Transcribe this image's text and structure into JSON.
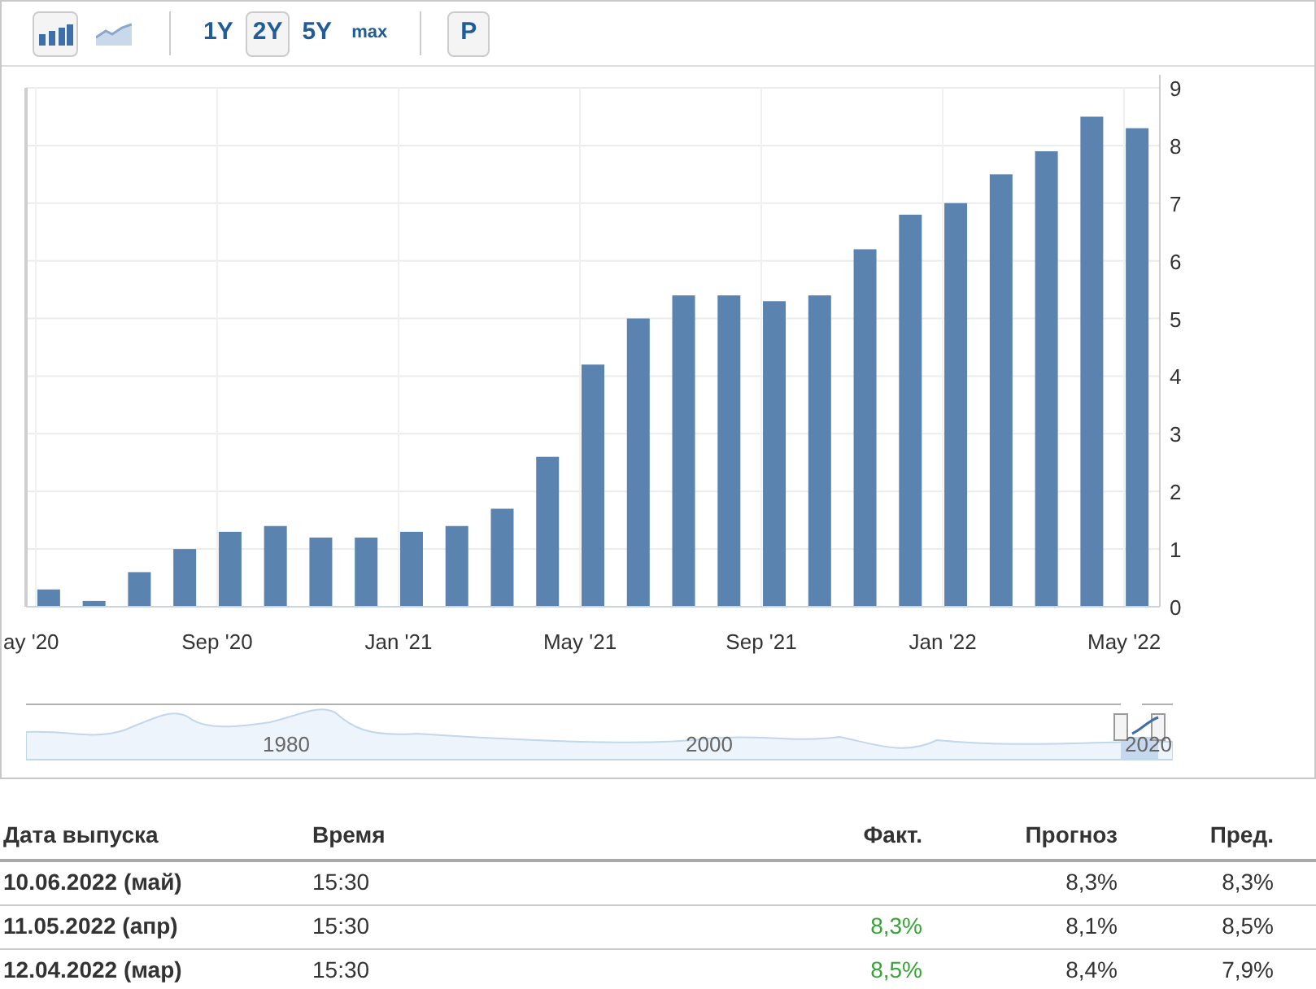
{
  "toolbar": {
    "chart_types": [
      {
        "kind": "bar",
        "selected": true
      },
      {
        "kind": "line",
        "selected": false
      }
    ],
    "ranges": [
      {
        "label": "1Y",
        "selected": false
      },
      {
        "label": "2Y",
        "selected": true
      },
      {
        "label": "5Y",
        "selected": false
      },
      {
        "label": "max",
        "selected": false
      }
    ],
    "extra_button": "P"
  },
  "chart": {
    "chart_data": {
      "type": "bar",
      "categories": [
        "ay '20",
        null,
        null,
        null,
        "Sep '20",
        null,
        null,
        null,
        "Jan '21",
        null,
        null,
        null,
        "May '21",
        null,
        null,
        null,
        "Sep '21",
        null,
        null,
        null,
        "Jan '22",
        null,
        null,
        null,
        "May '22"
      ],
      "grid": true,
      "series": [
        {
          "color": "#5b83b0",
          "values": [
            0.3,
            0.1,
            0.6,
            1.0,
            1.3,
            1.4,
            1.2,
            1.2,
            1.3,
            1.4,
            1.7,
            2.6,
            4.2,
            5.0,
            5.4,
            5.4,
            5.3,
            5.4,
            6.2,
            6.8,
            7.0,
            7.5,
            7.9,
            8.5,
            8.3
          ]
        }
      ],
      "ylim": [
        0,
        9
      ],
      "yticks": [
        0,
        1,
        2,
        3,
        4,
        5,
        6,
        7,
        8,
        9
      ]
    }
  },
  "navigator": {
    "labels": [
      "1980",
      "2000",
      "2020"
    ]
  },
  "table": {
    "columns": [
      "Дата выпуска",
      "Время",
      "Факт.",
      "Прогноз",
      "Пред."
    ],
    "rows": [
      {
        "date": "10.06.2022 (май)",
        "time": "15:30",
        "forecast": "8,3%",
        "previous": "8,3%"
      },
      {
        "date": "11.05.2022 (апр)",
        "time": "15:30",
        "actual": {
          "text": "8,3%",
          "color": "#32a532"
        },
        "forecast": "8,1%",
        "previous": "8,5%"
      },
      {
        "date": "12.04.2022 (мар)",
        "time": "15:30",
        "actual": {
          "text": "8,5%",
          "color": "#32a532"
        },
        "forecast": "8,4%",
        "previous": "7,9%"
      }
    ]
  }
}
